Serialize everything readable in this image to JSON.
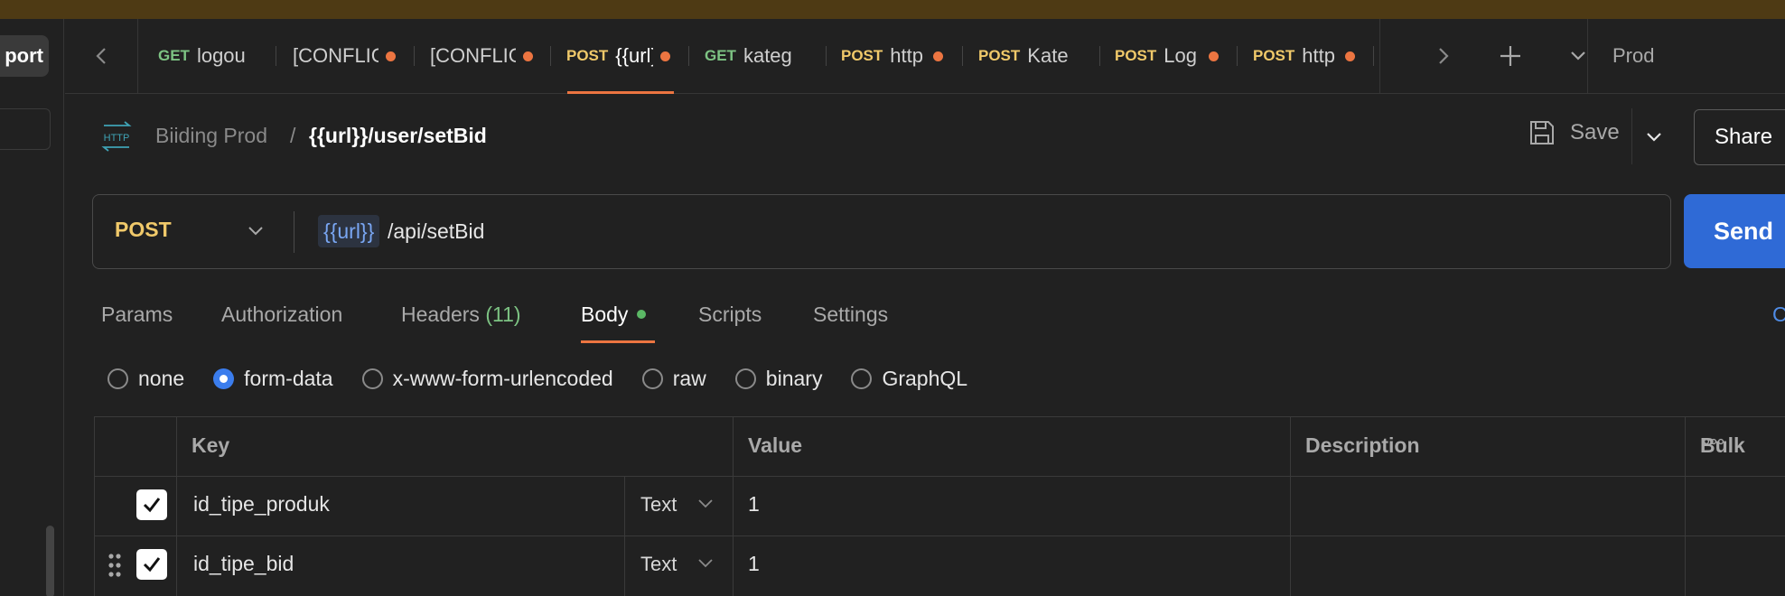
{
  "sidebar": {
    "import_label": "port"
  },
  "tabs": [
    {
      "method": "GET",
      "name": "logou",
      "dirty": false,
      "active": false
    },
    {
      "method": "",
      "name": "[CONFLIC",
      "dirty": true,
      "active": false
    },
    {
      "method": "",
      "name": "[CONFLIC",
      "dirty": true,
      "active": false
    },
    {
      "method": "POST",
      "name": "{{url}",
      "dirty": true,
      "active": true
    },
    {
      "method": "GET",
      "name": "kateg",
      "dirty": false,
      "active": false
    },
    {
      "method": "POST",
      "name": "http",
      "dirty": true,
      "active": false
    },
    {
      "method": "POST",
      "name": "Kate",
      "dirty": false,
      "active": false
    },
    {
      "method": "POST",
      "name": "Log",
      "dirty": true,
      "active": false
    },
    {
      "method": "POST",
      "name": "http",
      "dirty": true,
      "active": false
    }
  ],
  "environment": "Prod",
  "breadcrumb": {
    "collection": "Biiding Prod",
    "separator": "/",
    "request": "{{url}}/user/setBid"
  },
  "toolbar": {
    "save_label": "Save",
    "share_label": "Share"
  },
  "request": {
    "method": "POST",
    "url_variable": "{{url}}",
    "url_path": "/api/setBid",
    "send_label": "Send"
  },
  "request_tabs": [
    {
      "label": "Params",
      "count": ""
    },
    {
      "label": "Authorization",
      "count": ""
    },
    {
      "label": "Headers",
      "count": "(11)"
    },
    {
      "label": "Body",
      "count": ""
    },
    {
      "label": "Scripts",
      "count": ""
    },
    {
      "label": "Settings",
      "count": ""
    }
  ],
  "cookies_edge": "C",
  "body_types": [
    {
      "label": "none",
      "selected": false
    },
    {
      "label": "form-data",
      "selected": true
    },
    {
      "label": "x-www-form-urlencoded",
      "selected": false
    },
    {
      "label": "raw",
      "selected": false
    },
    {
      "label": "binary",
      "selected": false
    },
    {
      "label": "GraphQL",
      "selected": false
    }
  ],
  "table": {
    "headers": {
      "key": "Key",
      "value": "Value",
      "description": "Description",
      "bulk": "Bulk"
    },
    "rows": [
      {
        "checked": true,
        "key": "id_tipe_produk",
        "type": "Text",
        "value": "1",
        "description": ""
      },
      {
        "checked": true,
        "key": "id_tipe_bid",
        "type": "Text",
        "value": "1",
        "description": ""
      }
    ]
  },
  "colors": {
    "background": "#212121",
    "top_strip": "#4e3a14",
    "accent_orange": "#ec7541",
    "send_blue": "#2f6ad6",
    "post_method": "#f0c96a",
    "get_method": "#7dc383",
    "url_variable": "#79a6f2"
  }
}
